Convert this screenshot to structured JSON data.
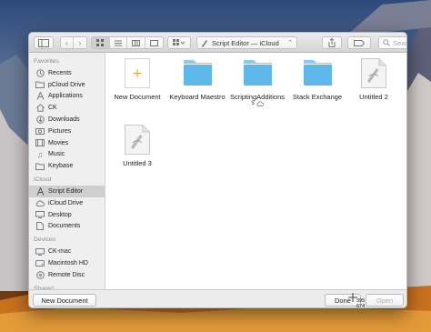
{
  "window": {
    "title": "Script Editor — iCloud",
    "search_placeholder": "Search"
  },
  "sidebar": {
    "sections": [
      {
        "header": "Favorites",
        "items": [
          {
            "label": "Recents",
            "icon": "clock-icon"
          },
          {
            "label": "pCloud Drive",
            "icon": "folder-icon"
          },
          {
            "label": "Applications",
            "icon": "applications-icon"
          },
          {
            "label": "CK",
            "icon": "home-icon"
          },
          {
            "label": "Downloads",
            "icon": "download-icon"
          },
          {
            "label": "Pictures",
            "icon": "camera-icon"
          },
          {
            "label": "Movies",
            "icon": "film-icon"
          },
          {
            "label": "Music",
            "icon": "music-icon"
          },
          {
            "label": "Keybase",
            "icon": "folder-icon"
          }
        ]
      },
      {
        "header": "iCloud",
        "items": [
          {
            "label": "Script Editor",
            "icon": "script-icon",
            "selected": true
          },
          {
            "label": "iCloud Drive",
            "icon": "cloud-icon"
          },
          {
            "label": "Desktop",
            "icon": "desktop-icon"
          },
          {
            "label": "Documents",
            "icon": "document-icon"
          }
        ]
      },
      {
        "header": "Devices",
        "items": [
          {
            "label": "CK-mac",
            "icon": "computer-icon"
          },
          {
            "label": "Macintosh HD",
            "icon": "disk-icon"
          },
          {
            "label": "Remote Disc",
            "icon": "disc-icon"
          }
        ]
      },
      {
        "header": "Shared",
        "items": []
      }
    ]
  },
  "files": [
    {
      "label": "New Document",
      "kind": "new-document-icon"
    },
    {
      "label": "Keyboard Maestro",
      "kind": "folder-icon"
    },
    {
      "label": "ScriptingAdditions",
      "kind": "folder-icon",
      "status": "$"
    },
    {
      "label": "Stack Exchange",
      "kind": "folder-icon"
    },
    {
      "label": "Untitled 2",
      "kind": "script-document-icon"
    },
    {
      "label": "Untitled 3",
      "kind": "script-document-icon"
    }
  ],
  "footer": {
    "new_document": "New Document",
    "done": "Done",
    "open": "Open",
    "cursor_coords": [
      "395",
      "674"
    ]
  },
  "colors": {
    "folder": "#5fb8ea",
    "selection": "#cfcfd2",
    "accent_orange": "#f39c34"
  }
}
